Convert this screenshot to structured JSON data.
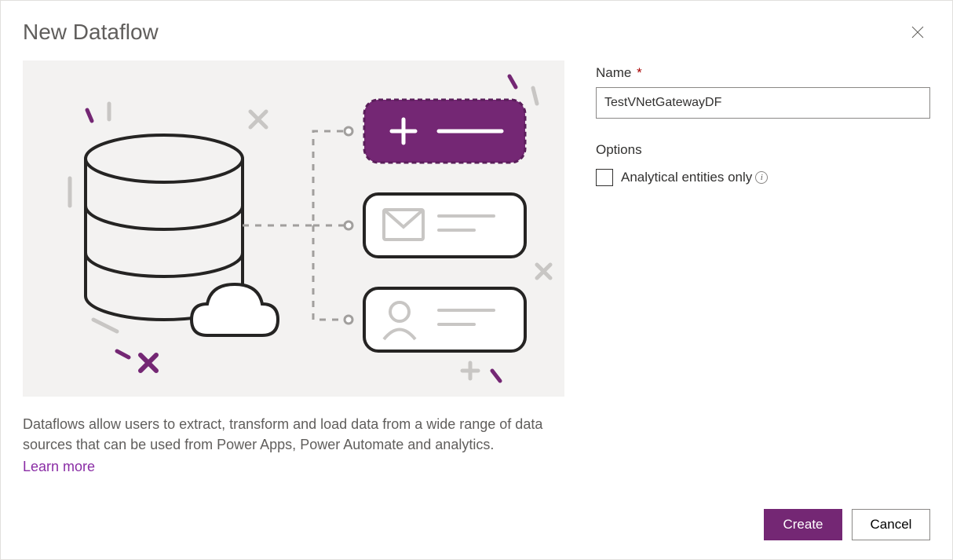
{
  "dialog": {
    "title": "New Dataflow",
    "description": "Dataflows allow users to extract, transform and load data from a wide range of data sources that can be used from Power Apps, Power Automate and analytics.",
    "learn_more_label": "Learn more"
  },
  "form": {
    "name": {
      "label": "Name",
      "required_mark": "*",
      "value": "TestVNetGatewayDF"
    },
    "options": {
      "section_label": "Options",
      "analytical_only": {
        "label": "Analytical entities only",
        "checked": false
      }
    }
  },
  "footer": {
    "create_label": "Create",
    "cancel_label": "Cancel"
  },
  "colors": {
    "accent": "#742774",
    "link": "#8a2da5",
    "illus_bg": "#f3f2f1"
  }
}
